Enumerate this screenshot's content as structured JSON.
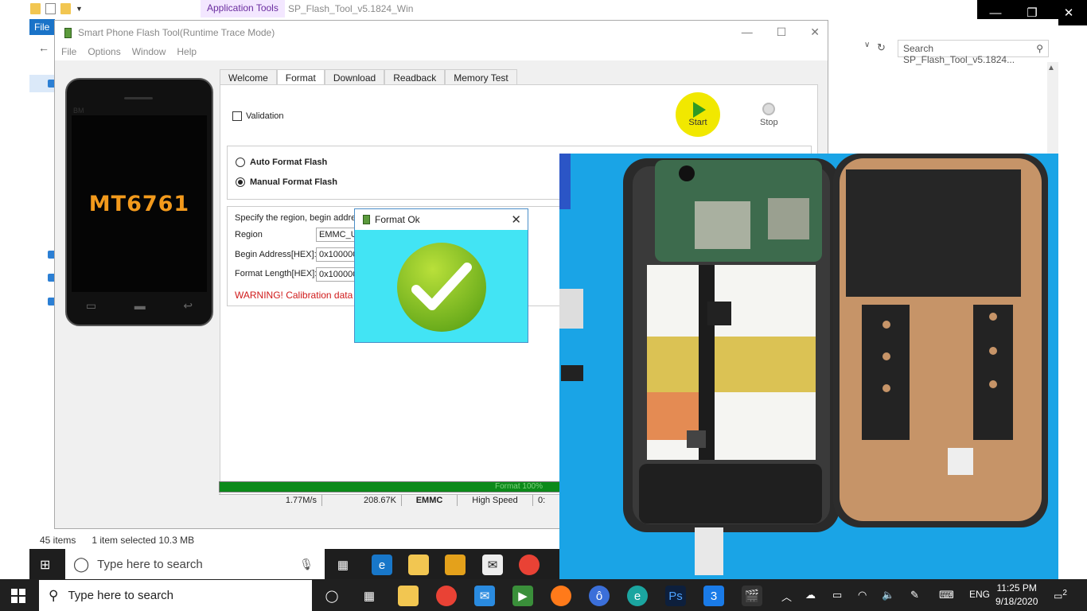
{
  "explorer": {
    "application_tools": "Application Tools",
    "title": "SP_Flash_Tool_v5.1824_Win",
    "file_tab": "File",
    "search_placeholder": "Search SP_Flash_Tool_v5.1824...",
    "status": {
      "items": "45 items",
      "selected": "1 item selected  10.3 MB"
    }
  },
  "flash_tool": {
    "title": "Smart Phone Flash Tool(Runtime Trace Mode)",
    "menu": [
      "File",
      "Options",
      "Window",
      "Help"
    ],
    "phone_chip": "MT6761",
    "tabs": [
      "Welcome",
      "Format",
      "Download",
      "Readback",
      "Memory Test"
    ],
    "active_tab": "Format",
    "validation_label": "Validation",
    "start_label": "Start",
    "stop_label": "Stop",
    "auto_format": "Auto Format Flash",
    "manual_format": "Manual Format Flash",
    "manual": {
      "hint": "Specify the region, begin address",
      "region_label": "Region",
      "region_value": "EMMC_USE",
      "begin_label": "Begin Address[HEX]:",
      "begin_value": "0x100000",
      "length_label": "Format Length[HEX]:",
      "length_value": "0x100000",
      "warning": "WARNING! Calibration data i"
    },
    "progress": {
      "text": "Format 100%",
      "value": 1.0
    },
    "statusbar": {
      "speed": "1.77M/s",
      "size": "208.67K",
      "storage": "EMMC",
      "mode": "High Speed",
      "time": "0:"
    }
  },
  "dialog": {
    "title": "Format Ok"
  },
  "inner_taskbar": {
    "search": "Type here to search"
  },
  "taskbar": {
    "search": "Type here to search",
    "language": "ENG",
    "time": "11:25 PM",
    "date": "9/18/2020",
    "notifications": "2"
  },
  "colors": {
    "progress_green": "#0c8a1a",
    "warning_red": "#d01a1a",
    "dialog_bg": "#42e4f4",
    "start_yellow": "#f1e800"
  }
}
